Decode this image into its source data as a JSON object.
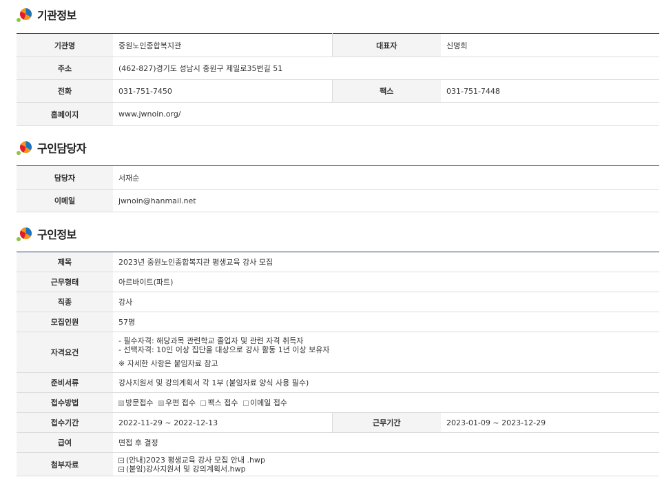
{
  "org": {
    "title": "기관정보",
    "name_label": "기관명",
    "name": "중원노인종합복지관",
    "ceo_label": "대표자",
    "ceo": "신명희",
    "address_label": "주소",
    "address": "(462-827)경기도 성남시 중원구 제일로35번길 51",
    "phone_label": "전화",
    "phone": "031-751-7450",
    "fax_label": "팩스",
    "fax": "031-751-7448",
    "homepage_label": "홈페이지",
    "homepage": "www.jwnoin.org/"
  },
  "contact": {
    "title": "구인담당자",
    "person_label": "담당자",
    "person": "서재순",
    "email_label": "이메일",
    "email": "jwnoin@hanmail.net"
  },
  "job": {
    "title": "구인정보",
    "subject_label": "제목",
    "subject": "2023년 중원노인종합복지관 평생교육 강사 모집",
    "type_label": "근무형태",
    "type": "아르바이트(파트)",
    "category_label": "직종",
    "category": "강사",
    "count_label": "모집인원",
    "count": "57명",
    "qual_label": "자격요건",
    "qual_line1": "- 필수자격: 해당과목 관련학교 졸업자 및 관련 자격 취득자",
    "qual_line2": "- 선택자격: 10인 이상 집단을 대상으로 강사 활동 1년 이상 보유자",
    "qual_note": "※ 자세한 사항은 붙임자료 참고",
    "docs_label": "준비서류",
    "docs": "강사지원서 및 강의계획서 각 1부 (붙임자료 양식 사용 필수)",
    "method_label": "접수방법",
    "methods": [
      "방문접수",
      "우편 접수",
      "팩스 접수",
      "이메일 접수"
    ],
    "period_label": "접수기간",
    "period": "2022-11-29 ~ 2022-12-13",
    "work_period_label": "근무기간",
    "work_period": "2023-01-09 ~ 2023-12-29",
    "pay_label": "급여",
    "pay": "면접 후 결정",
    "attach_label": "첨부자료",
    "attach1": "(안내)2023 평생교육 강사 모집 안내 .hwp",
    "attach2": "(붙임)강사지원서 및 강의계획서.hwp"
  }
}
